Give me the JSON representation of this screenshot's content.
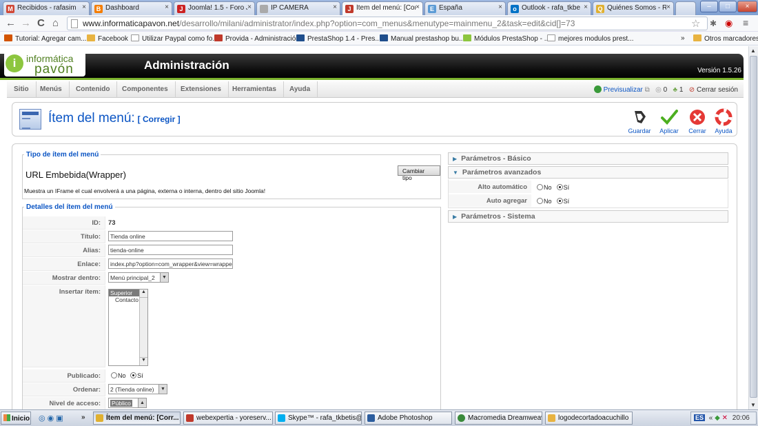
{
  "browser": {
    "tabs": [
      {
        "label": "Recibidos - rafasimn",
        "icon": "gmail-icon",
        "color": "#d14836"
      },
      {
        "label": "Dashboard",
        "icon": "blogger-icon",
        "color": "#f57d00"
      },
      {
        "label": "Joomla! 1.5 - Foro J",
        "icon": "joomla-forum-icon",
        "color": "#cc2222"
      },
      {
        "label": "IP CAMERA",
        "icon": "page-icon",
        "color": "#999999"
      },
      {
        "label": "Ítem del menú: [Cor",
        "icon": "joomla-icon",
        "color": "#c0392b"
      },
      {
        "label": "España",
        "icon": "map-icon",
        "color": "#5b9bd5"
      },
      {
        "label": "Outlook - rafa_tkbe",
        "icon": "outlook-icon",
        "color": "#0072c6"
      },
      {
        "label": "Quiénes Somos - Re",
        "icon": "site-icon",
        "color": "#e0b030"
      }
    ],
    "url_host": "www.informaticapavon.net",
    "url_path": "/desarrollo/milani/administrator/index.php?option=com_menus&menutype=mainmenu_2&task=edit&cid[]=73",
    "bookmarks": [
      {
        "label": "Tutorial: Agregar cam...",
        "color": "#d35400"
      },
      {
        "label": "Facebook",
        "color": "#e8b341"
      },
      {
        "label": "Utilizar Paypal como fo...",
        "color": "#999999"
      },
      {
        "label": "Provida - Administración",
        "color": "#c0392b"
      },
      {
        "label": "PrestaShop 1.4 - Pres...",
        "color": "#1f4e8c"
      },
      {
        "label": "Manual prestashop bu...",
        "color": "#1f4e8c"
      },
      {
        "label": "Módulos PrestaShop - ...",
        "color": "#8dc63f"
      },
      {
        "label": "mejores modulos prest...",
        "color": "#999999"
      }
    ],
    "bookmarks_more": "»",
    "other_bookmarks": "Otros marcadores"
  },
  "header": {
    "logo_top": "informática",
    "logo_bottom": "pavón",
    "title": "Administración",
    "version": "Versión 1.5.26"
  },
  "menu": {
    "items": [
      "Sitio",
      "Menús",
      "Contenido",
      "Componentes",
      "Extensiones",
      "Herramientas",
      "Ayuda"
    ],
    "preview": "Previsualizar",
    "messages_count": "0",
    "users_count": "1",
    "logout": "Cerrar sesión"
  },
  "toolbar": {
    "title": "Ítem del menú:",
    "subtitle": "[ Corregir ]",
    "buttons": {
      "save": "Guardar",
      "apply": "Aplicar",
      "close": "Cerrar",
      "help": "Ayuda"
    }
  },
  "type_section": {
    "legend": "Tipo de ítem del menú",
    "type_name": "URL Embebida(Wrapper)",
    "change_button": "Cambiar tipo",
    "description": "Muestra un IFrame el cual envolverá a una página, externa o interna, dentro del sitio Joomla!"
  },
  "details": {
    "legend": "Detalles del ítem del menú",
    "id_label": "ID:",
    "id_value": "73",
    "title_label": "Título:",
    "title_value": "Tienda online",
    "alias_label": "Alias:",
    "alias_value": "tienda-online",
    "link_label": "Enlace:",
    "link_value": "index.php?option=com_wrapper&view=wrapper",
    "show_in_label": "Mostrar dentro:",
    "show_in_value": "Menú principal_2",
    "insert_label": "Insertar ítem:",
    "insert_options": [
      "Superior",
      "Contacto"
    ],
    "published_label": "Publicado:",
    "order_label": "Ordenar:",
    "order_value": "2 (Tienda online)",
    "access_label": "Nivel de acceso:",
    "access_value": "Público",
    "no": "No",
    "yes": "Sí"
  },
  "params": {
    "basic": "Parámetros - Básico",
    "advanced": "Parámetros avanzados",
    "auto_height_label": "Alto automático",
    "auto_add_label": "Auto agregar",
    "system": "Parámetros - Sistema",
    "no": "No",
    "yes": "Sí"
  },
  "taskbar": {
    "start": "Inicio",
    "tasks": [
      {
        "label": "Ítem del menú: [Corr...",
        "color": "#e0b030",
        "active": true
      },
      {
        "label": "webexpertia - yoreserv...",
        "color": "#c0392b",
        "active": false
      },
      {
        "label": "Skype™ - rafa_tkbetis@...",
        "color": "#00aff0",
        "active": false
      },
      {
        "label": "Adobe Photoshop",
        "color": "#2c5d9e",
        "active": false
      },
      {
        "label": "Macromedia Dreamweav...",
        "color": "#3a8a3a",
        "active": false
      },
      {
        "label": "logodecortadoacuchillo",
        "color": "#e8b341",
        "active": false
      }
    ],
    "lang": "ES",
    "clock": "20:06"
  }
}
